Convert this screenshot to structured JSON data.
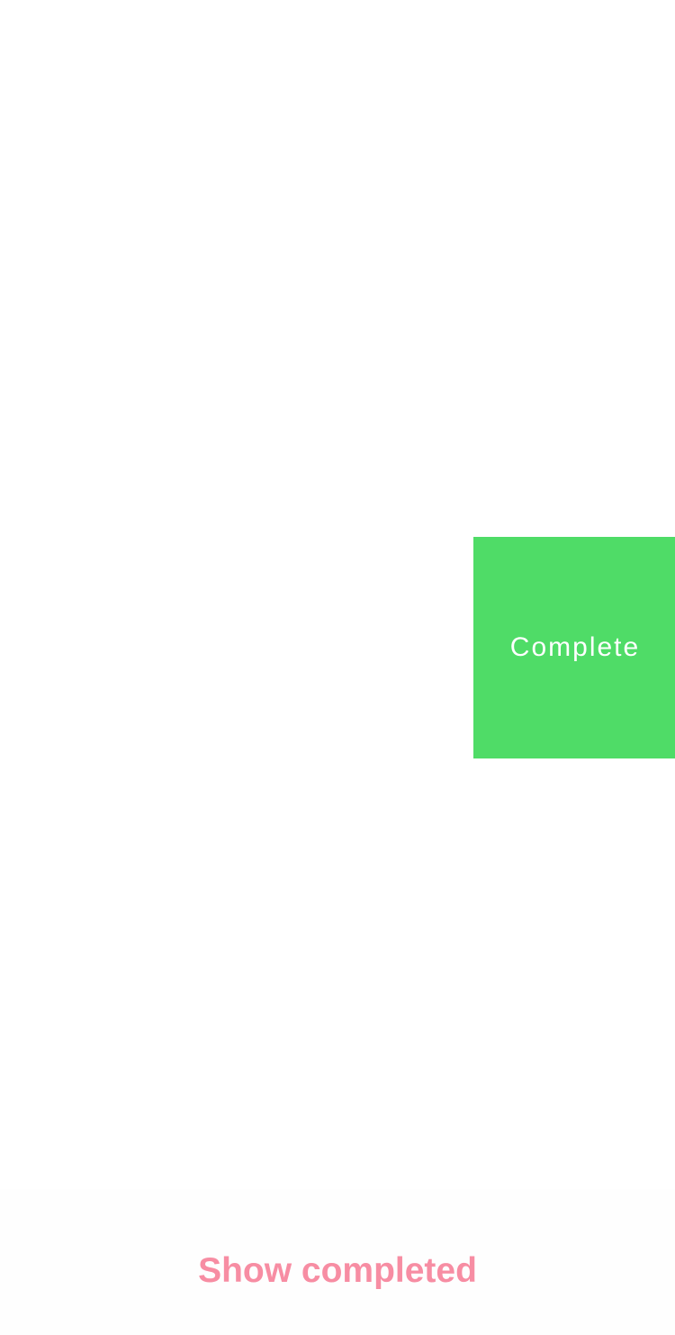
{
  "colors": {
    "background": "#ffffff",
    "complete_action": "#4fdc67",
    "accent_pink": "#f78da3",
    "text_on_green": "#ffffff"
  },
  "swipe_row": {
    "complete_label": "Complete"
  },
  "footer": {
    "show_completed_label": "Show completed"
  }
}
